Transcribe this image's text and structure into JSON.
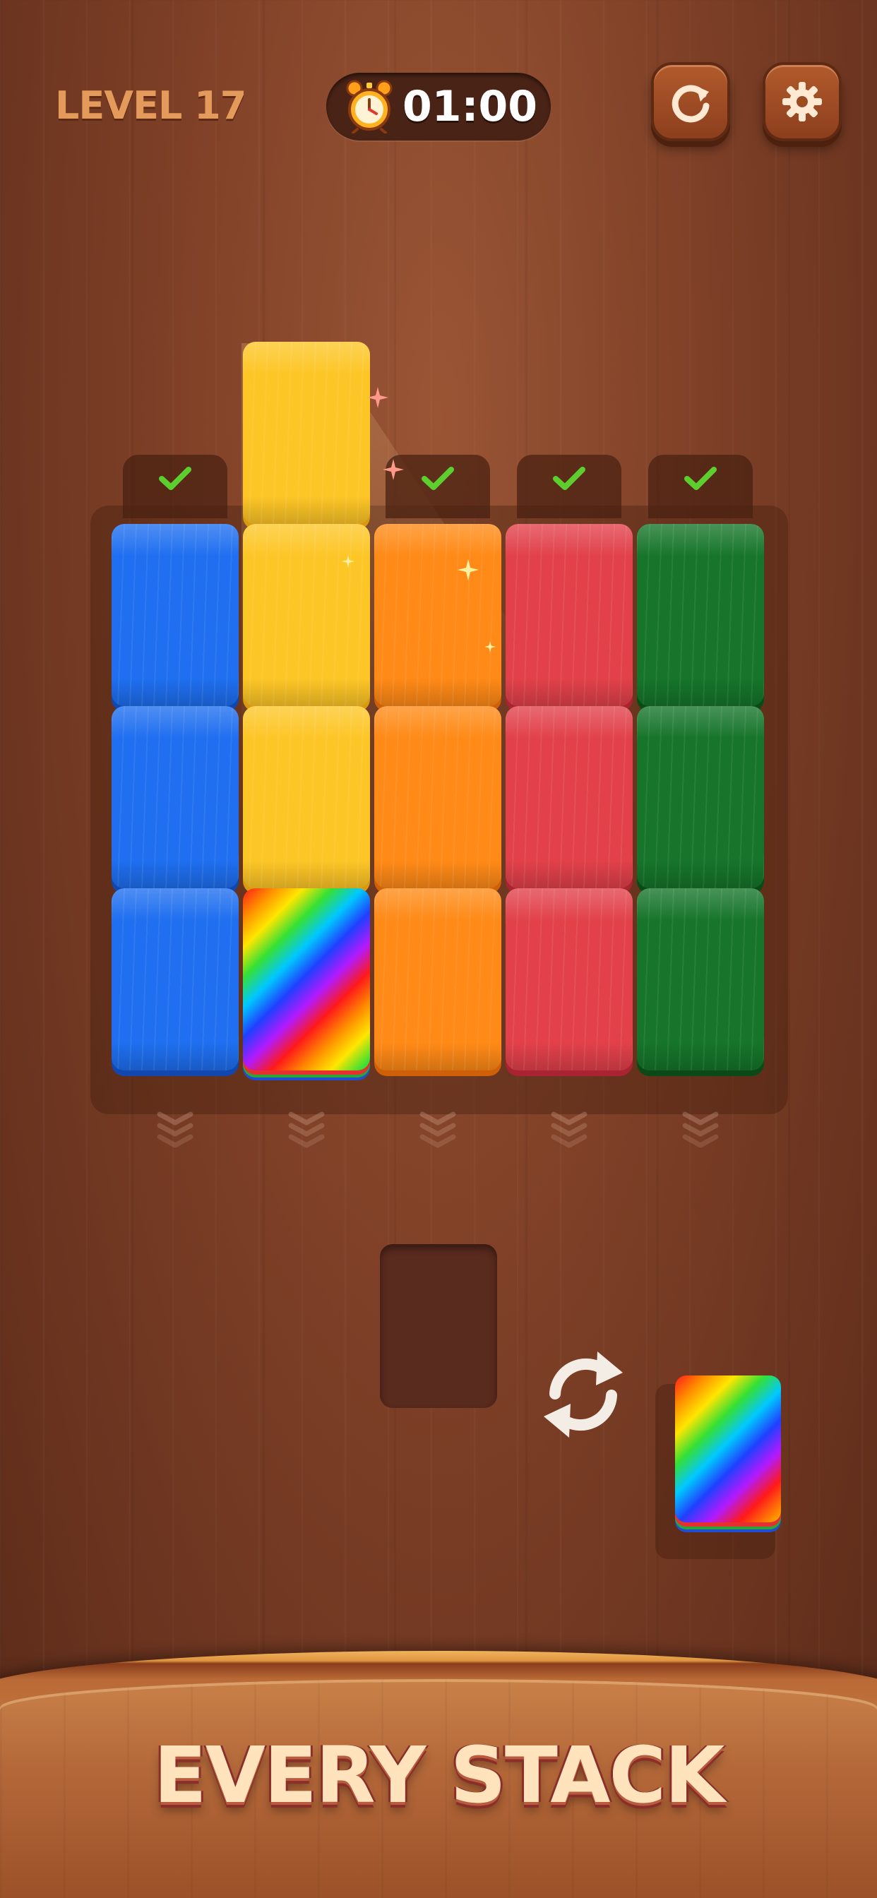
{
  "header": {
    "level_label": "LEVEL 17",
    "timer": "01:00",
    "restart_icon": "restart-icon",
    "settings_icon": "gear-icon",
    "timer_icon": "alarm-clock-icon"
  },
  "board": {
    "columns": [
      {
        "color": "blue",
        "completed": true
      },
      {
        "color": "yellow",
        "completed": false
      },
      {
        "color": "orange",
        "completed": true
      },
      {
        "color": "red",
        "completed": true
      },
      {
        "color": "green",
        "completed": true
      }
    ],
    "rows": [
      [
        "blue",
        "yellow",
        "orange",
        "red",
        "green"
      ],
      [
        "blue",
        "yellow",
        "orange",
        "red",
        "green"
      ],
      [
        "blue",
        "rainbow",
        "orange",
        "red",
        "green"
      ]
    ],
    "lifted_tile": {
      "color": "yellow",
      "column": 2
    },
    "colors": {
      "blue": "#1f6ff0",
      "yellow": "#fdc627",
      "orange": "#ff8a17",
      "red": "#e2414a",
      "green": "#16752a",
      "check": "#5ccf2e"
    }
  },
  "tray": {
    "empty_slot": true,
    "swap_icon": "swap-arrows-icon",
    "next_tile": "rainbow"
  },
  "banner": {
    "title": "EVERY STACK"
  }
}
